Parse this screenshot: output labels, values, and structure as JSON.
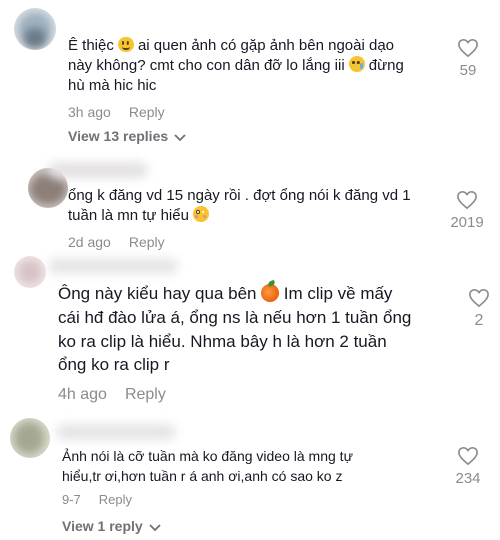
{
  "comments": [
    {
      "lines": [
        "Ê thiệc",
        "ai quen ảnh có gặp ảnh bên ngoài dạo",
        "này không? cmt cho con dân đỡ lo lắng iii",
        "đừng",
        "hù mà hic hic"
      ],
      "emojis": [
        "slightly-smiling-face",
        "crying-face"
      ],
      "time": "3h ago",
      "reply": "Reply",
      "likes": "59",
      "view_replies": "View 13 replies"
    },
    {
      "lines": [
        "ổng k đăng vd 15 ngày rồi . đợt ổng nói k đăng vd 1",
        "tuần là mn tự hiểu"
      ],
      "emojis": [
        "flushed-face"
      ],
      "time": "2d ago",
      "reply": "Reply",
      "likes": "2019"
    },
    {
      "lines": [
        "Ông này kiểu hay qua bên",
        "Im clip về mấy",
        "cái hđ đào lửa á, ổng ns là nếu hơn 1 tuần ổng",
        "ko ra clip là hiểu. Nhma bây h là hơn 2 tuần",
        "ổng ko ra clip r"
      ],
      "emojis": [
        "peach"
      ],
      "time": "4h ago",
      "reply": "Reply",
      "likes": "2"
    },
    {
      "lines": [
        "Ảnh nói là cỡ tuần mà ko đăng video là mng tự",
        "hiểu,tr ơi,hơn tuần r á anh ơi,anh có sao ko z"
      ],
      "time": "9-7",
      "reply": "Reply",
      "likes": "234",
      "view_replies": "View 1 reply"
    }
  ],
  "colors": {
    "text": "#161823",
    "meta": "#8a8b91",
    "view_replies": "#6f7076"
  }
}
